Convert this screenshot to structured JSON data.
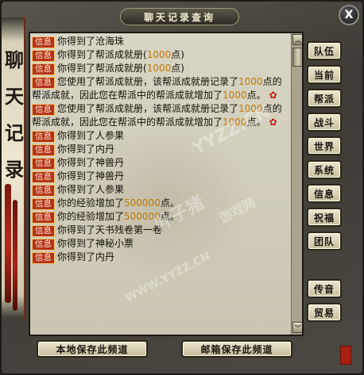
{
  "window": {
    "title": "聊天记录查询",
    "close_label": "X"
  },
  "banner": {
    "chars": [
      "聊",
      "天",
      "记",
      "录"
    ]
  },
  "messages": [
    {
      "tag": "信息",
      "text": "你得到了沧海珠"
    },
    {
      "tag": "信息",
      "text": "你得到了帮派成就册(1000点)"
    },
    {
      "tag": "信息",
      "text": "你得到了帮派成就册(1000点)"
    },
    {
      "tag": "信息",
      "text": "您使用了帮派成就册，该帮派成就册记录了1000点的帮派成就，因此您在帮派中的帮派成就增加了1000点。"
    },
    {
      "tag": "信息",
      "text": "您使用了帮派成就册，该帮派成就册记录了1000点的帮派成就，因此您在帮派中的帮派成就增加了1000点。"
    },
    {
      "tag": "信息",
      "text": "你得到了人参果"
    },
    {
      "tag": "信息",
      "text": "你得到了内丹"
    },
    {
      "tag": "信息",
      "text": "你得到了神兽丹"
    },
    {
      "tag": "信息",
      "text": "你得到了神兽丹"
    },
    {
      "tag": "信息",
      "text": "你得到了人参果"
    },
    {
      "tag": "信息",
      "text": "你的经验增加了500000点。"
    },
    {
      "tag": "信息",
      "text": "你的经验增加了500000点。"
    },
    {
      "tag": "信息",
      "text": "你得到了天书残卷第一卷"
    },
    {
      "tag": "信息",
      "text": "你得到了神秘小票"
    },
    {
      "tag": "信息",
      "text": "你得到了内丹"
    }
  ],
  "side_buttons": [
    "队伍",
    "当前",
    "帮派",
    "战斗",
    "世界",
    "系统",
    "信息",
    "祝福",
    "团队",
    "传音",
    "贸易"
  ],
  "bottom_buttons": {
    "local_save": "本地保存此频道",
    "mail_save": "邮箱保存此频道"
  },
  "watermarks": [
    "YYZZ.CN",
    "叶子猪",
    "游戏网",
    "WWW.YYZZ.CN"
  ],
  "colors": {
    "tag_bg": "#b4321c",
    "number": "#c07a00",
    "panel_bg": "#d8d5c4"
  },
  "icons": {
    "scroll_up": "double-chevron-up",
    "scroll_down": "double-chevron-down",
    "rose": "rose-icon"
  }
}
